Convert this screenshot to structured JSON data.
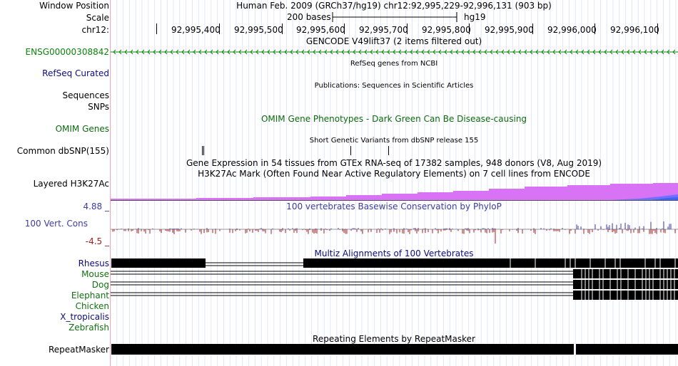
{
  "header": {
    "window_position_label": "Window Position",
    "window_position_value": "Human Feb. 2009 (GRCh37/hg19)   chr12:92,995,229-92,996,131 (903 bp)",
    "scale_label": "Scale",
    "scale_bases": "200 bases",
    "scale_assembly": "hg19",
    "chrom_label": "chr12:",
    "positions": [
      "92,995,400",
      "92,995,500",
      "92,995,600",
      "92,995,700",
      "92,995,800",
      "92,995,900",
      "92,996,000",
      "92,996,100"
    ]
  },
  "tracks": {
    "gencode_title": "GENCODE V49lift37 (2 items filtered out)",
    "gencode_item": "ENSG00000308842",
    "refseq_label": "RefSeq Curated",
    "refseq_title": "RefSeq genes from NCBI",
    "sequences_label": "Sequences",
    "publications_title": "Publications: Sequences in Scientific Articles",
    "snps_label": "SNPs",
    "omim_title": "OMIM Gene Phenotypes - Dark Green Can Be Disease-causing",
    "omim_label": "OMIM Genes",
    "dbsnp_title": "Short Genetic Variants from dbSNP release 155",
    "dbsnp_label": "Common dbSNP(155)",
    "gtex_title": "Gene Expression in 54 tissues from GTEx RNA-seq of 17382 samples, 948 donors (V8, Aug 2019)",
    "h3k27_title": "H3K27Ac Mark (Often Found Near Active Regulatory Elements) on 7 cell lines from ENCODE",
    "h3k27_label": "Layered H3K27Ac",
    "cons_max": "4.88 _",
    "cons_title": "100 vertebrates Basewise Conservation by PhyloP",
    "cons_label": "100 Vert. Cons",
    "cons_min": "-4.5 _",
    "multiz_title": "Multiz Alignments of 100 Vertebrates",
    "species": [
      "Rhesus",
      "Mouse",
      "Dog",
      "Elephant",
      "Chicken",
      "X_tropicalis",
      "Zebrafish"
    ],
    "repeat_title": "Repeating Elements by RepeatMasker",
    "repeat_label": "RepeatMasker"
  },
  "colors": {
    "label_gray_bar": "#000000",
    "gencode": "#0c840c",
    "refseq": "#0c0c78",
    "omim": "#0c6b0c",
    "conservation": "#3c3ca0",
    "cons_neg": "#a02020",
    "h3k27_magenta": "#d873f5",
    "h3k27_blue": "#4060ff",
    "species_rhesus": "#0c0c78",
    "species_green": "#127012",
    "gridline": "#d8d8ff",
    "left_rule": "#e08080"
  }
}
